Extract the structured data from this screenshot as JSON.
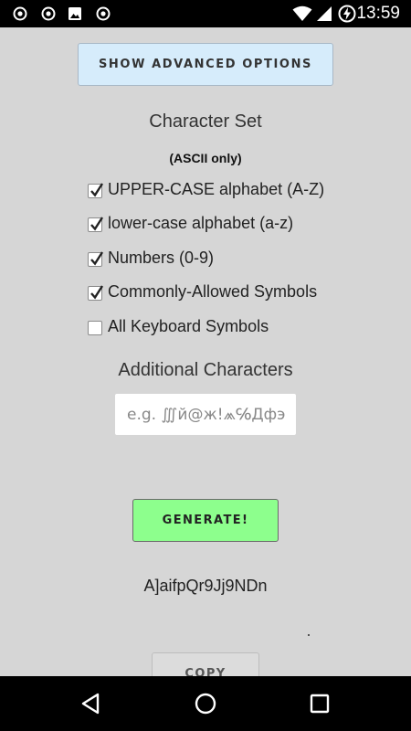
{
  "status_bar": {
    "time": "13:59",
    "icons": [
      "target-icon",
      "target-icon",
      "image-icon",
      "target-icon",
      "wifi-icon",
      "signal-icon",
      "battery-charging-icon"
    ]
  },
  "advanced_button": {
    "label": "SHOW ADVANCED OPTIONS"
  },
  "character_set": {
    "title": "Character Set",
    "note": "(ASCII only)",
    "options": [
      {
        "label": "UPPER-CASE alphabet (A-Z)",
        "checked": true
      },
      {
        "label": "lower-case alphabet (a-z)",
        "checked": true
      },
      {
        "label": "Numbers (0-9)",
        "checked": true
      },
      {
        "label": "Commonly-Allowed Symbols",
        "checked": true
      },
      {
        "label": "All Keyboard Symbols",
        "checked": false
      }
    ]
  },
  "additional_characters": {
    "title": "Additional Characters",
    "placeholder": "e.g. ∭й@ж!⩕℅Дфэ",
    "value": ""
  },
  "generate_button": {
    "label": "GENERATE!"
  },
  "result": {
    "password": "A]aifpQr9Jj9NDn"
  },
  "copy_button": {
    "label": "COPY"
  },
  "nav_bar": {
    "icons": [
      "back-icon",
      "home-icon",
      "recents-icon"
    ]
  },
  "colors": {
    "background": "#d6d6d6",
    "advanced_button": "#d6ecfb",
    "generate_button": "#8dff8d",
    "status_bar": "#000000"
  }
}
